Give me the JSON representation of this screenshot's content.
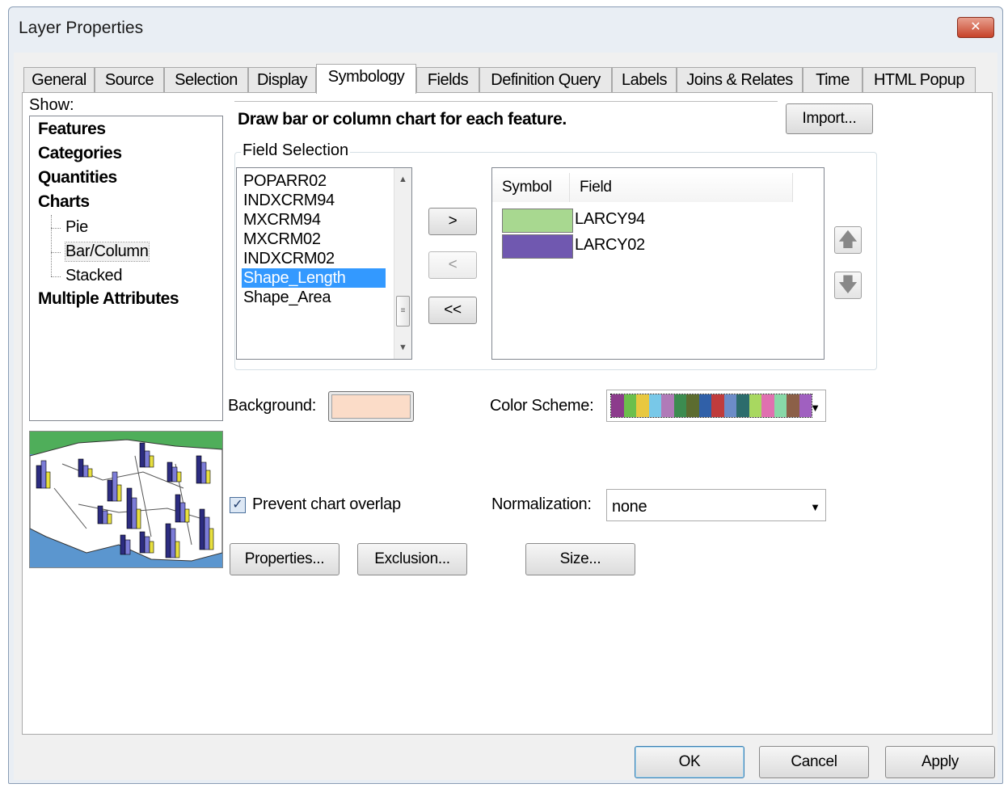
{
  "window": {
    "title": "Layer Properties",
    "close_glyph": "✕"
  },
  "tabs": [
    {
      "label": "General"
    },
    {
      "label": "Source"
    },
    {
      "label": "Selection"
    },
    {
      "label": "Display"
    },
    {
      "label": "Symbology",
      "active": true
    },
    {
      "label": "Fields"
    },
    {
      "label": "Definition Query"
    },
    {
      "label": "Labels"
    },
    {
      "label": "Joins & Relates"
    },
    {
      "label": "Time"
    },
    {
      "label": "HTML Popup"
    }
  ],
  "show": {
    "label": "Show:",
    "items": {
      "features": "Features",
      "categories": "Categories",
      "quantities": "Quantities",
      "charts": "Charts",
      "pie": "Pie",
      "bar_column": "Bar/Column",
      "stacked": "Stacked",
      "multiple_attributes": "Multiple Attributes"
    },
    "selected": "Bar/Column"
  },
  "description": "Draw bar or column chart for each feature.",
  "import_button": "Import...",
  "field_selection": {
    "label": "Field Selection",
    "fields": [
      "POPARR02",
      "INDXCRM94",
      "MXCRM94",
      "MXCRM02",
      "INDXCRM02",
      "Shape_Length",
      "Shape_Area"
    ],
    "selected_index": 5,
    "buttons": {
      "add": ">",
      "remove": "<",
      "remove_all": "<<"
    }
  },
  "symbol_table": {
    "headers": {
      "symbol": "Symbol",
      "field": "Field"
    },
    "rows": [
      {
        "color": "#a8d890",
        "field": "LARCY94"
      },
      {
        "color": "#7058b0",
        "field": "LARCY02"
      }
    ],
    "move_up_icon": "🡅",
    "move_down_icon": "🡇"
  },
  "background": {
    "label": "Background:",
    "color": "#fbdcc8"
  },
  "color_scheme": {
    "label": "Color Scheme:",
    "colors": [
      "#8c3c8c",
      "#6cbf4c",
      "#e8c840",
      "#78c8e8",
      "#b07ab8",
      "#3c8c50",
      "#5c6c30",
      "#3060a8",
      "#c03c3c",
      "#6c8cc8",
      "#2c6c6c",
      "#a8d860",
      "#e070b0",
      "#88d8a8",
      "#8c6048",
      "#a060c0"
    ]
  },
  "prevent_overlap": {
    "label": "Prevent chart overlap",
    "checked": true,
    "check_glyph": "✓"
  },
  "normalization": {
    "label": "Normalization:",
    "value": "none"
  },
  "dropdown_glyph": "▼",
  "action_buttons": {
    "properties": "Properties...",
    "exclusion": "Exclusion...",
    "size": "Size..."
  },
  "footer": {
    "ok": "OK",
    "cancel": "Cancel",
    "apply": "Apply"
  }
}
